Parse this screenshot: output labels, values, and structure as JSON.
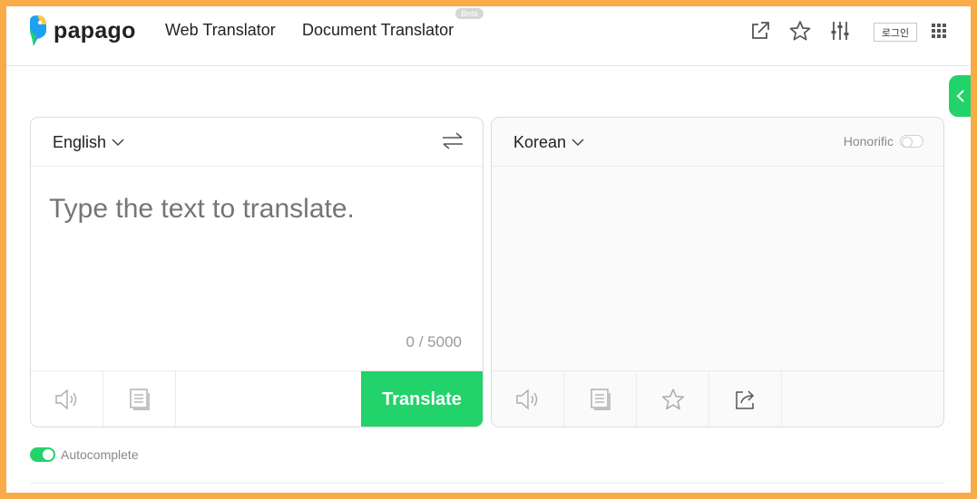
{
  "header": {
    "logo_text": "papago",
    "nav": [
      {
        "label": "Web Translator"
      },
      {
        "label": "Document Translator"
      }
    ],
    "beta_badge": "Beta",
    "login_label": "로그인",
    "icons": [
      "external-link-icon",
      "star-icon",
      "settings-sliders-icon",
      "apps-grid-icon"
    ]
  },
  "source": {
    "language": "English",
    "placeholder": "Type the text to translate.",
    "value": "",
    "counter": "0 / 5000",
    "translate_label": "Translate"
  },
  "target": {
    "language": "Korean",
    "honorific_label": "Honorific",
    "honorific_enabled": false
  },
  "autocomplete": {
    "label": "Autocomplete",
    "enabled": true
  },
  "colors": {
    "accent": "#21d36a",
    "frame": "#f8ab47"
  }
}
